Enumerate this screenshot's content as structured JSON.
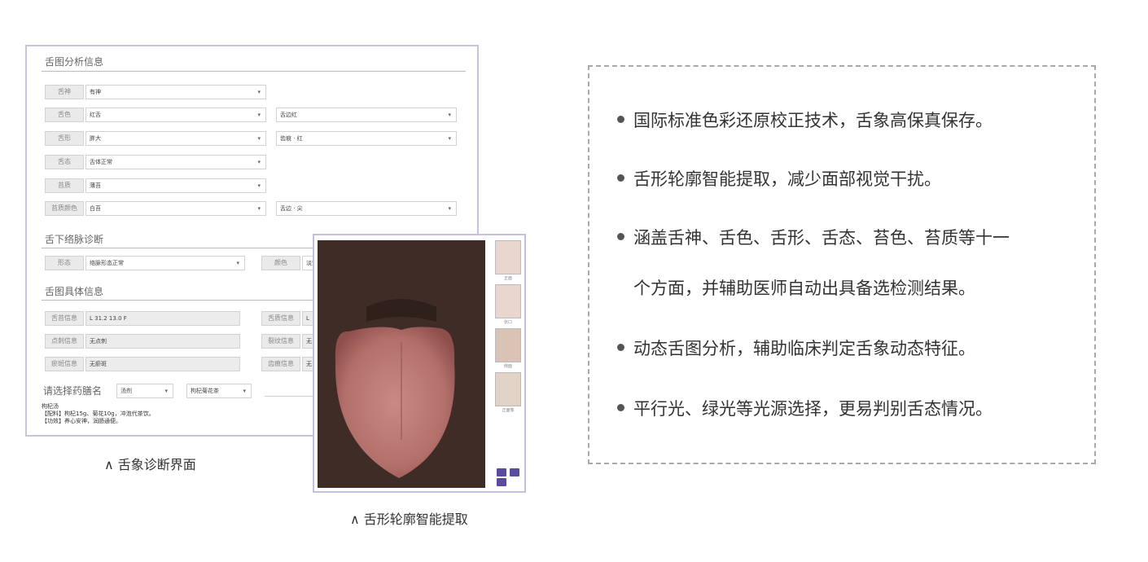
{
  "left_screenshot": {
    "section1_title": "舌图分析信息",
    "rows1": [
      {
        "label": "舌神",
        "value": "有神",
        "value2": ""
      },
      {
        "label": "舌色",
        "value": "红舌",
        "value2": "舌边红"
      },
      {
        "label": "舌形",
        "value": "胖大",
        "value2": "齿痕 · 红"
      },
      {
        "label": "舌态",
        "value": "舌体正常",
        "value2": ""
      },
      {
        "label": "苔质",
        "value": "薄苔",
        "value2": ""
      },
      {
        "label": "苔质颜色",
        "value": "白苔",
        "value2": "舌边 · 尖"
      }
    ],
    "section2_title": "舌下络脉诊断",
    "row2": {
      "label": "形态",
      "value": "络脉形态正常",
      "label2": "颜色",
      "value2": "淡紫"
    },
    "section3_title": "舌图具体信息",
    "rows3": [
      {
        "label": "舌苔信息",
        "value": "L 31.2  13.0  F",
        "label2": "舌质信息",
        "value2": "L"
      },
      {
        "label": "点刺信息",
        "value": "无点刺",
        "label2": "裂纹信息",
        "value2": "无"
      },
      {
        "label": "瘀斑信息",
        "value": "无瘀斑",
        "label2": "齿痕信息",
        "value2": "无"
      }
    ],
    "prescription": {
      "label": "请选择药膳名",
      "select1": "汤剂",
      "select2": "枸杞菊花茶"
    },
    "notes": [
      "枸杞汤",
      "【配料】枸杞15g、菊花10g，冲泡代茶饮。",
      "【功效】养心安神，润肠通便。"
    ]
  },
  "tongue_panel": {
    "thumb_captions": [
      "正面",
      "张口",
      "侧面",
      "正面像"
    ]
  },
  "captions": {
    "left": "∧ 舌象诊断界面",
    "right": "∧ 舌形轮廓智能提取"
  },
  "features": [
    "国际标准色彩还原校正技术，舌象高保真保存。",
    "舌形轮廓智能提取，减少面部视觉干扰。",
    "涵盖舌神、舌色、舌形、舌态、苔色、苔质等十一",
    "个方面，并辅助医师自动出具备选检测结果。",
    "动态舌图分析，辅助临床判定舌象动态特征。",
    "平行光、绿光等光源选择，更易判别舌态情况。"
  ],
  "colors": {
    "panel_border": "#c8c2dc",
    "button": "#5b4a9c",
    "dashed_border": "#a9a9a9"
  }
}
